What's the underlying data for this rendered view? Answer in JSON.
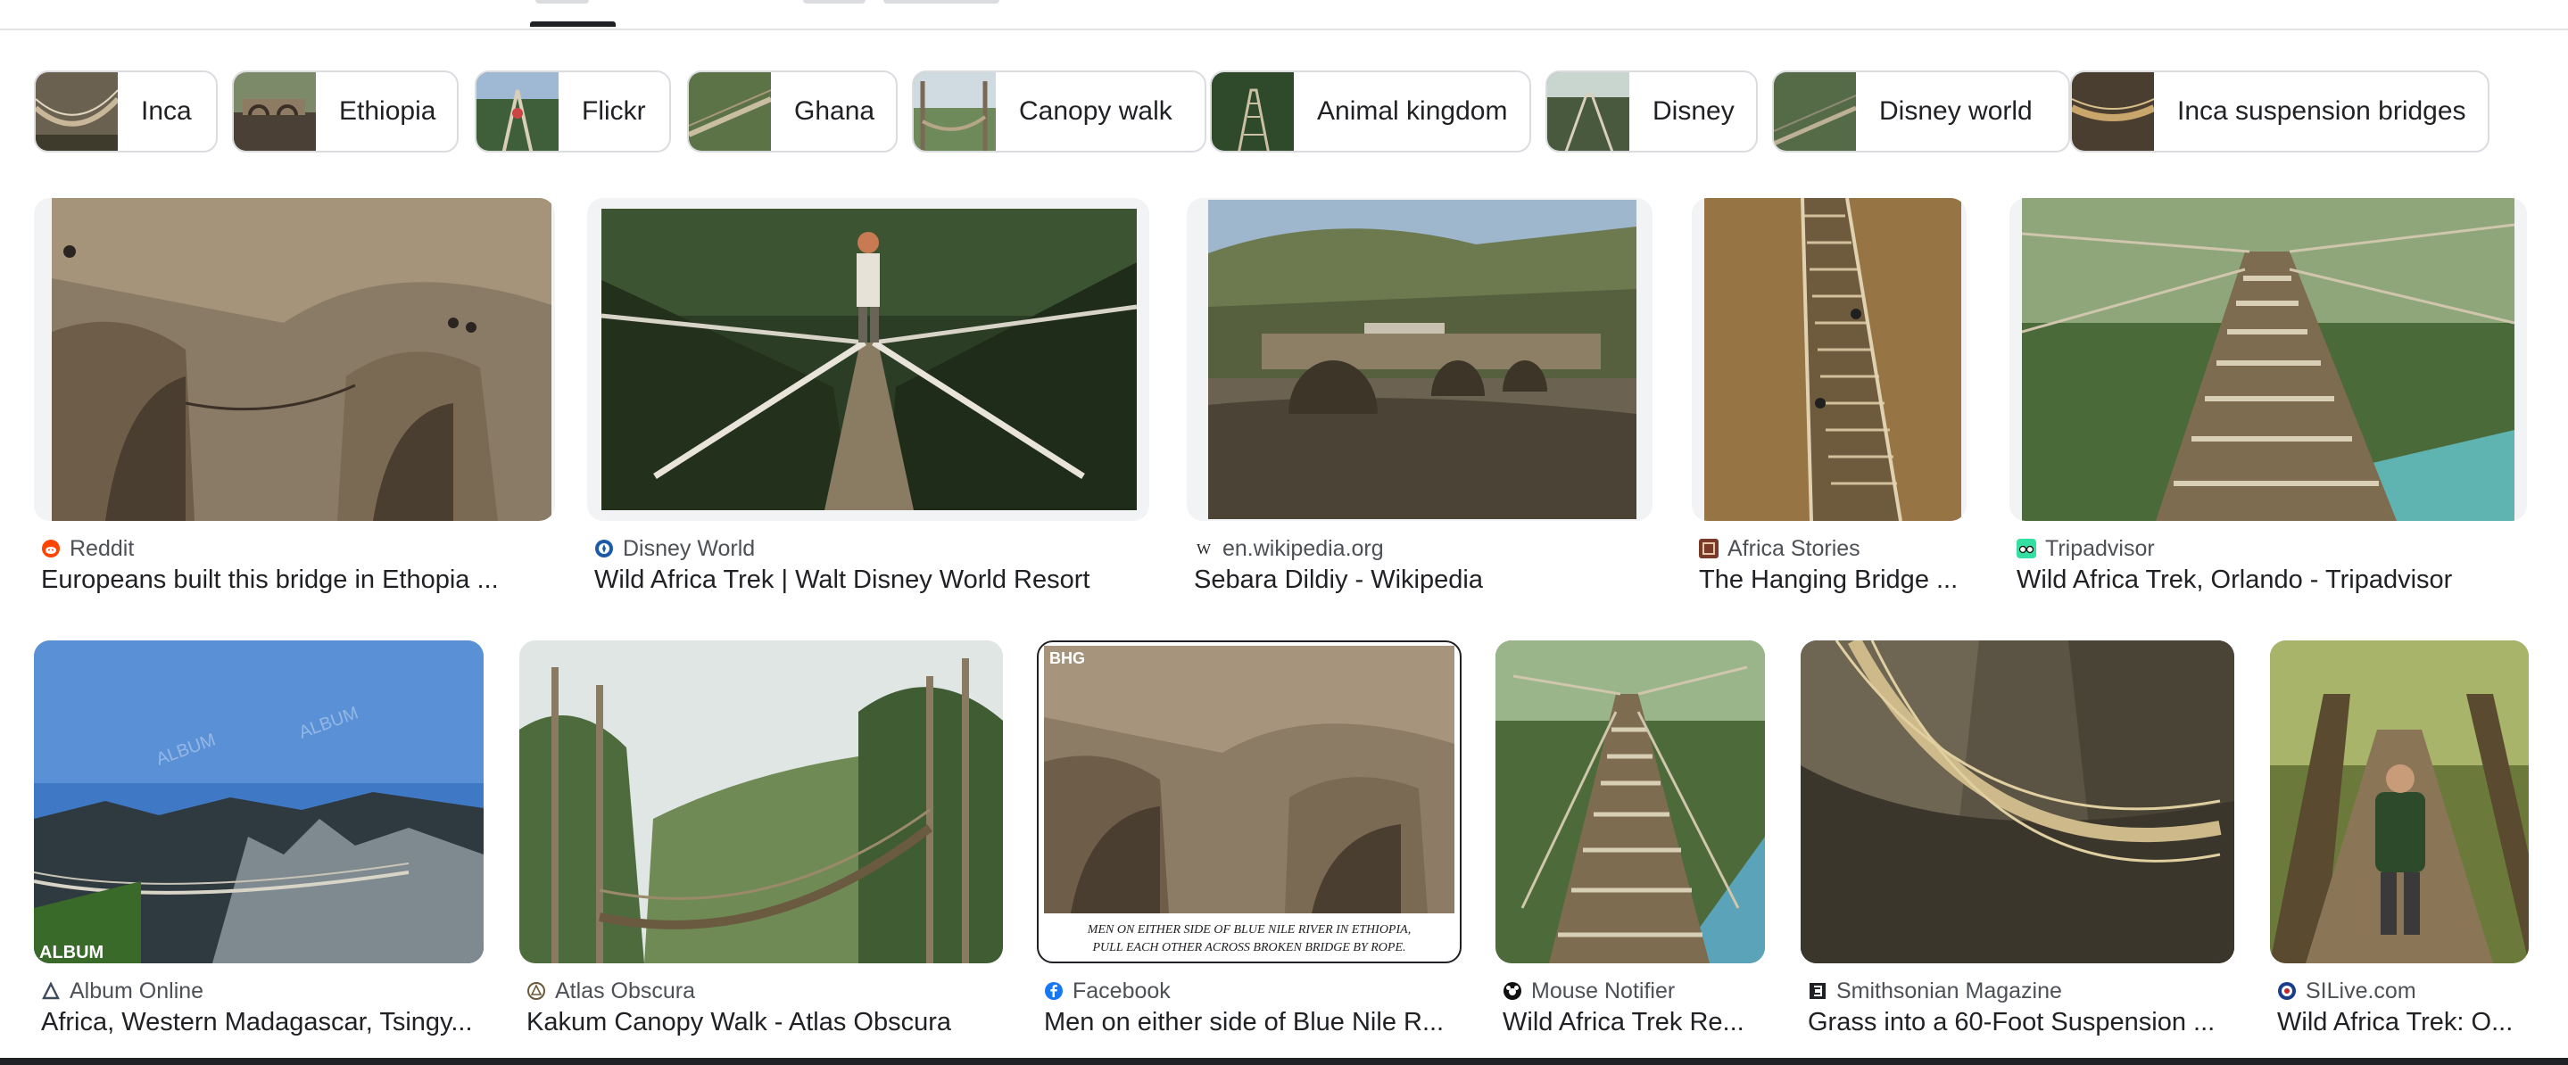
{
  "tabs": {
    "active_index": 0
  },
  "chips": [
    {
      "label": "Inca"
    },
    {
      "label": "Ethiopia"
    },
    {
      "label": "Flickr"
    },
    {
      "label": "Ghana"
    },
    {
      "label": "Canopy walk"
    },
    {
      "label": "Animal kingdom"
    },
    {
      "label": "Disney"
    },
    {
      "label": "Disney world"
    },
    {
      "label": "Inca suspension bridges"
    }
  ],
  "results_row1": [
    {
      "source": "Reddit",
      "source_icon": "reddit-icon",
      "title": "Europeans built this bridge in Ethopia ..."
    },
    {
      "source": "Disney World",
      "source_icon": "disney-world-icon",
      "title": "Wild Africa Trek | Walt Disney World Resort"
    },
    {
      "source": "en.wikipedia.org",
      "source_icon": "wikipedia-icon",
      "title": "Sebara Dildiy - Wikipedia"
    },
    {
      "source": "Africa Stories",
      "source_icon": "africa-stories-icon",
      "title": "The Hanging Bridge ..."
    },
    {
      "source": "Tripadvisor",
      "source_icon": "tripadvisor-icon",
      "title": "Wild Africa Trek, Orlando - Tripadvisor"
    }
  ],
  "results_row2": [
    {
      "source": "Album Online",
      "source_icon": "album-online-icon",
      "title": "Africa, Western Madagascar, Tsingy..."
    },
    {
      "source": "Atlas Obscura",
      "source_icon": "atlas-obscura-icon",
      "title": "Kakum Canopy Walk - Atlas Obscura"
    },
    {
      "source": "Facebook",
      "source_icon": "facebook-icon",
      "title": "Men on either side of Blue Nile R..."
    },
    {
      "source": "Mouse Notifier",
      "source_icon": "mouse-notifier-icon",
      "title": "Wild Africa Trek Re..."
    },
    {
      "source": "Smithsonian Magazine",
      "source_icon": "smithsonian-icon",
      "title": "Grass into a 60-Foot Suspension ..."
    },
    {
      "source": "SILive.com",
      "source_icon": "silive-icon",
      "title": "Wild Africa Trek: O..."
    }
  ],
  "image_overlays": {
    "album_watermark": "ALBUM",
    "bhg_mark": "BHG",
    "facebook_caption_line1": "MEN ON EITHER SIDE OF BLUE NILE RIVER IN ETHIOPIA,",
    "facebook_caption_line2": "PULL EACH OTHER ACROSS BROKEN BRIDGE BY ROPE."
  },
  "colors": {
    "reddit": "#ff4500",
    "facebook": "#1877f2",
    "tripadvisor": "#34e0a1",
    "disney": "#1b5aa6"
  }
}
